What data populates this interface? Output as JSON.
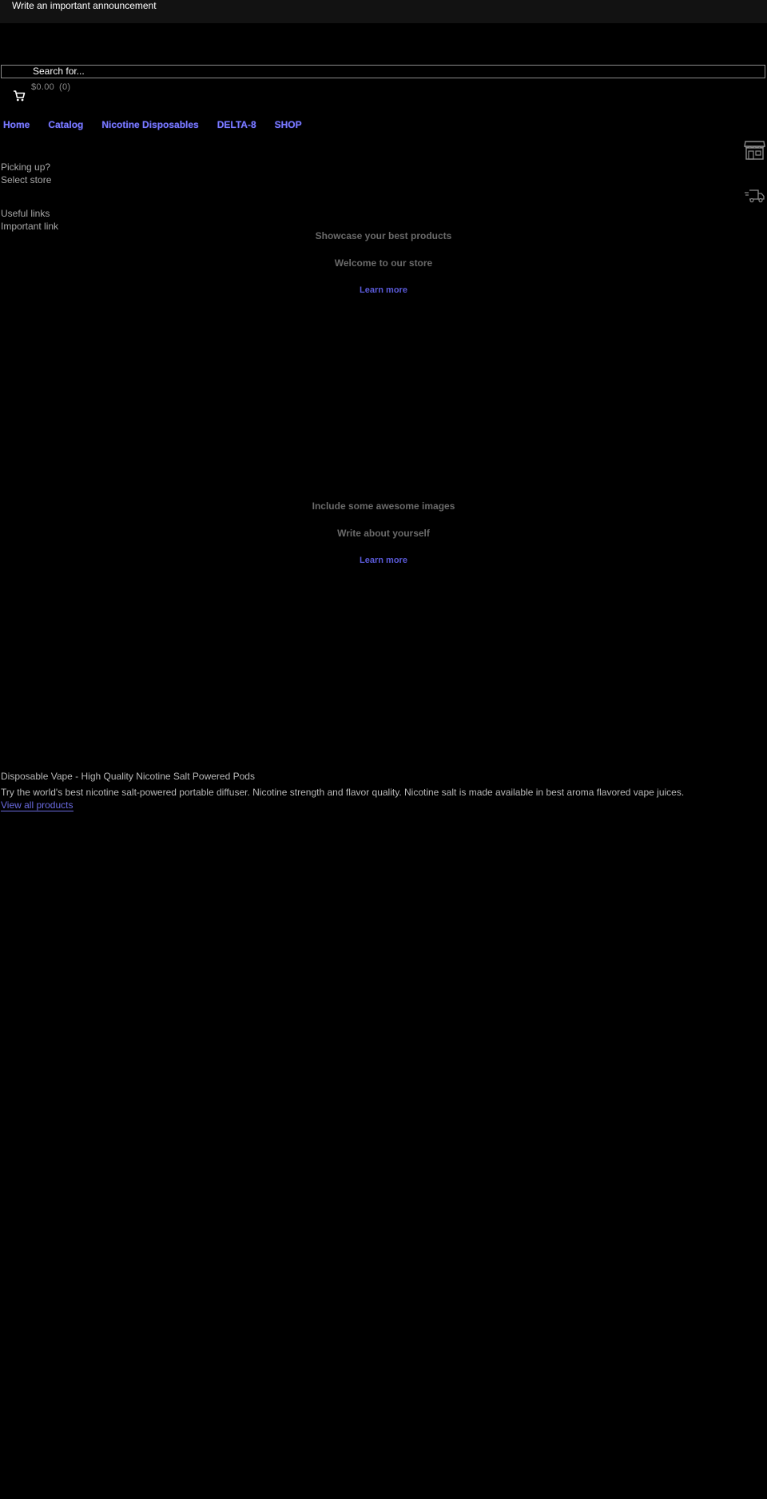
{
  "announcement": {
    "text": "Write an important announcement"
  },
  "search": {
    "placeholder": "Search for..."
  },
  "cart": {
    "total": "$0.00",
    "count": "(0)"
  },
  "nav": {
    "items": [
      {
        "label": "Home"
      },
      {
        "label": "Catalog"
      },
      {
        "label": "Nicotine Disposables"
      },
      {
        "label": "DELTA-8"
      },
      {
        "label": "SHOP"
      }
    ]
  },
  "info": {
    "pickup_question": "Picking up?",
    "select_store": "Select store",
    "useful_links": "Useful links",
    "important_link": "Important link"
  },
  "slides": [
    {
      "heading": "Showcase your best products",
      "sub": "Welcome to our store",
      "cta": "Learn more"
    },
    {
      "heading": "Include some awesome images",
      "sub": "Write about yourself",
      "cta": "Learn more"
    }
  ],
  "collection": {
    "title": "Disposable Vape - High Quality Nicotine Salt Powered Pods",
    "description": "Try the world's best nicotine salt-powered portable diffuser. Nicotine strength and flavor quality. Nicotine salt is made available in best aroma flavored vape juices.",
    "view_all": "View all products"
  },
  "colors": {
    "background": "#000000",
    "announcement_bar": "#121212",
    "link": "#7a7aff",
    "muted_text": "#6a6a6a"
  }
}
